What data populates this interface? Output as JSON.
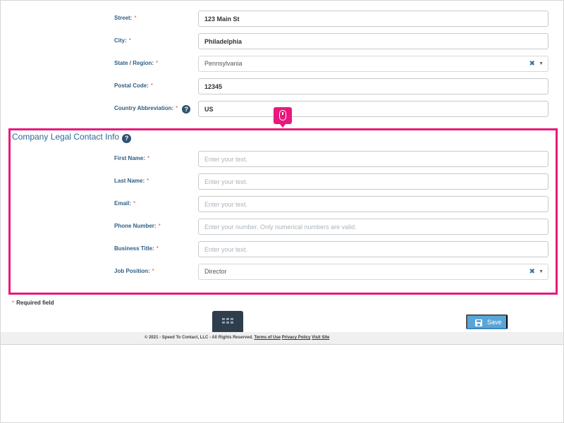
{
  "address": {
    "street": {
      "label": "Street:",
      "value": "123 Main St"
    },
    "city": {
      "label": "City:",
      "value": "Philadelphia"
    },
    "state": {
      "label": "State / Region:",
      "value": "Pennsylvania"
    },
    "postal": {
      "label": "Postal Code:",
      "value": "12345"
    },
    "country": {
      "label": "Country Abbreviation:",
      "value": "US"
    }
  },
  "required_marker": "*",
  "help_glyph": "?",
  "section": {
    "title": "Company Legal Contact Info"
  },
  "contact": {
    "first_name": {
      "label": "First Name:",
      "placeholder": "Enter your text."
    },
    "last_name": {
      "label": "Last Name:",
      "placeholder": "Enter your text."
    },
    "email": {
      "label": "Email:",
      "placeholder": "Enter your text."
    },
    "phone": {
      "label": "Phone Number:",
      "placeholder": "Enter your number. Only numerical numbers are valid."
    },
    "business_title": {
      "label": "Business Title:",
      "placeholder": "Enter your text."
    },
    "job_position": {
      "label": "Job Position:",
      "value": "Director"
    }
  },
  "select_clear_glyph": "✖",
  "select_caret_glyph": "▼",
  "required_note": "Required field",
  "save_label": "Save",
  "footer": {
    "copyright": "© 2021 - Speed To Contact, LLC - All Rights Reserved.",
    "terms": "Terms of Use",
    "privacy": "Privacy Policy",
    "visit": "Visit Site"
  },
  "colors": {
    "highlight": "#e8197d",
    "label": "#2d5f86",
    "save_button": "#5aa5d8",
    "grid_button": "#2f3d4c"
  }
}
